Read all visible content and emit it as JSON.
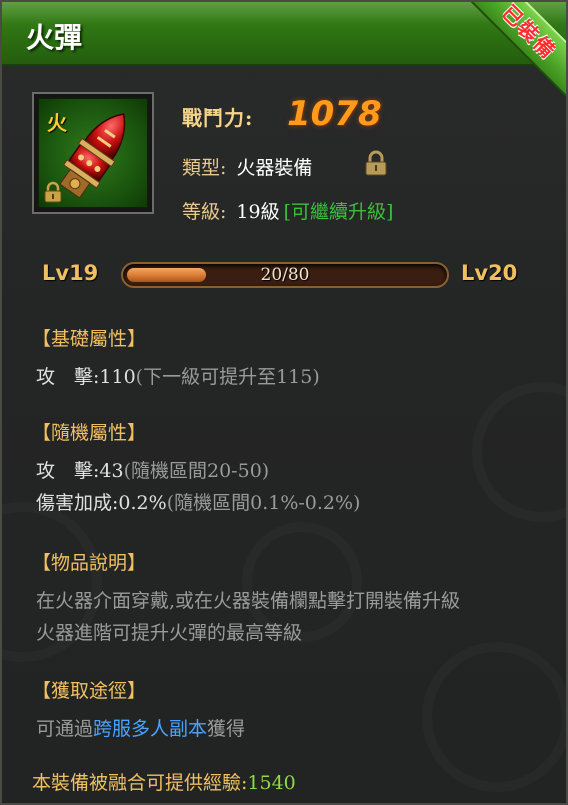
{
  "item": {
    "name": "火彈",
    "ribbon_text": "已裝備",
    "icon_char": "火",
    "power_label": "戰鬥力:",
    "power_value": "1078",
    "type_label": "類型:",
    "type_value": "火器裝備",
    "level_label": "等級:",
    "level_value": "19級",
    "level_upgrade": "[可繼續升級]"
  },
  "exp": {
    "left_level": "Lv19",
    "right_level": "Lv20",
    "text": "20/80",
    "fraction": 0.25
  },
  "base_attrs": {
    "header": "【基礎屬性】",
    "attack_label": "攻　擊:",
    "attack_value": "110",
    "attack_note": "(下一級可提升至115)"
  },
  "random_attrs": {
    "header": "【隨機屬性】",
    "attack_label": "攻　擊:",
    "attack_value": "43",
    "attack_note": "(隨機區間20-50)",
    "dmg_label": "傷害加成:",
    "dmg_value": "0.2%",
    "dmg_note": "(隨機區間0.1%-0.2%)"
  },
  "description": {
    "header": "【物品說明】",
    "line1": "在火器介面穿戴,或在火器裝備欄點擊打開裝備升級",
    "line2": "火器進階可提升火彈的最高等級"
  },
  "acquire": {
    "header": "【獲取途徑】",
    "prefix": "可通過",
    "link": "跨服多人副本",
    "suffix": "獲得"
  },
  "fusion": {
    "label": "本裝備被融合可提供經驗:",
    "value": "1540"
  },
  "colors": {
    "title_green": "#2f7414",
    "gold": "#f0c060",
    "power_orange": "#ff9a1a",
    "link_blue": "#4aa3ff",
    "value_green": "#8fd94a"
  }
}
